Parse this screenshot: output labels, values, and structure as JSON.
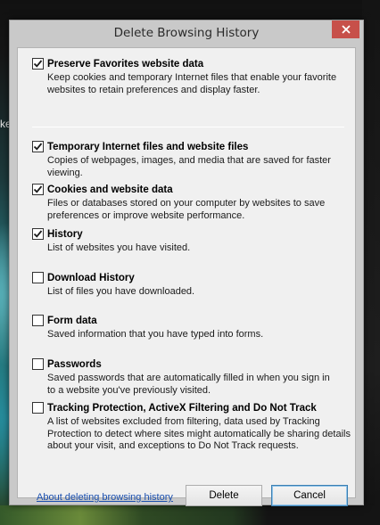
{
  "desktop": {
    "left_text": "ke"
  },
  "window": {
    "title": "Delete Browsing History",
    "close_icon": "close-icon"
  },
  "options": [
    {
      "id": "preserve-favorites",
      "label": "Preserve Favorites website data",
      "checked": true,
      "description": "Keep cookies and temporary Internet files that enable your favorite\nwebsites to retain preferences and display faster."
    },
    {
      "id": "temporary-internet-files",
      "label": "Temporary Internet files and website files",
      "checked": true,
      "description": "Copies of webpages, images, and media that are saved for faster\nviewing."
    },
    {
      "id": "cookies",
      "label": "Cookies and website data",
      "checked": true,
      "description": "Files or databases stored on your computer by websites to save\npreferences or improve website performance."
    },
    {
      "id": "history",
      "label": "History",
      "checked": true,
      "description": "List of websites you have visited."
    },
    {
      "id": "download-history",
      "label": "Download History",
      "checked": false,
      "description": "List of files you have downloaded."
    },
    {
      "id": "form-data",
      "label": "Form data",
      "checked": false,
      "description": "Saved information that you have typed into forms."
    },
    {
      "id": "passwords",
      "label": "Passwords",
      "checked": false,
      "description": "Saved passwords that are automatically filled in when you sign in\nto a website you've previously visited."
    },
    {
      "id": "tracking-protection",
      "label": "Tracking Protection, ActiveX Filtering and Do Not Track",
      "checked": false,
      "description": "A list of websites excluded from filtering, data used by Tracking\nProtection to detect where sites might automatically be sharing details\nabout your visit, and exceptions to Do Not Track requests."
    }
  ],
  "footer": {
    "about_link": "About deleting browsing history",
    "delete_label": "Delete",
    "cancel_label": "Cancel"
  },
  "colors": {
    "close_button": "#c7504a",
    "link": "#1a4fae"
  }
}
